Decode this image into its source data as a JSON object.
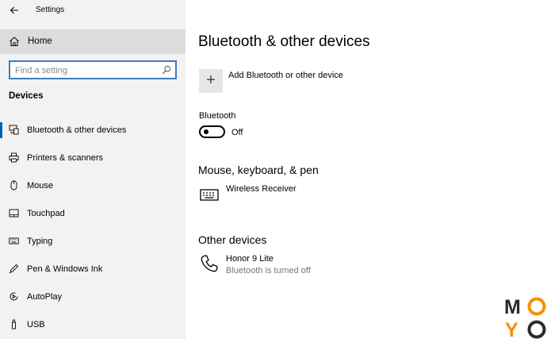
{
  "window": {
    "title": "Settings"
  },
  "sidebar": {
    "home_label": "Home",
    "search_placeholder": "Find a setting",
    "section_title": "Devices",
    "items": [
      {
        "label": "Bluetooth & other devices",
        "icon": "bluetooth-devices-icon",
        "active": true
      },
      {
        "label": "Printers & scanners",
        "icon": "printer-icon"
      },
      {
        "label": "Mouse",
        "icon": "mouse-icon"
      },
      {
        "label": "Touchpad",
        "icon": "touchpad-icon"
      },
      {
        "label": "Typing",
        "icon": "keyboard-icon"
      },
      {
        "label": "Pen & Windows Ink",
        "icon": "pen-icon"
      },
      {
        "label": "AutoPlay",
        "icon": "autoplay-icon"
      },
      {
        "label": "USB",
        "icon": "usb-icon"
      }
    ]
  },
  "main": {
    "title": "Bluetooth & other devices",
    "add_device_label": "Add Bluetooth or other device",
    "bluetooth_label": "Bluetooth",
    "bluetooth_state": "Off",
    "sections": [
      {
        "heading": "Mouse, keyboard, & pen",
        "devices": [
          {
            "name": "Wireless Receiver",
            "status": "",
            "icon": "keyboard-icon"
          }
        ]
      },
      {
        "heading": "Other devices",
        "devices": [
          {
            "name": "Honor 9 Lite",
            "status": "Bluetooth is turned off",
            "icon": "phone-icon"
          }
        ]
      }
    ]
  },
  "watermark": {
    "letters": [
      "M",
      "O",
      "Y",
      "O"
    ]
  },
  "colors": {
    "accent": "#0063b1",
    "search_border": "#3e7bc2",
    "sidebar_bg": "#f2f2f2",
    "home_bg": "#dcdcdc",
    "logo_orange": "#f39200",
    "logo_dark": "#2b2b2b"
  }
}
